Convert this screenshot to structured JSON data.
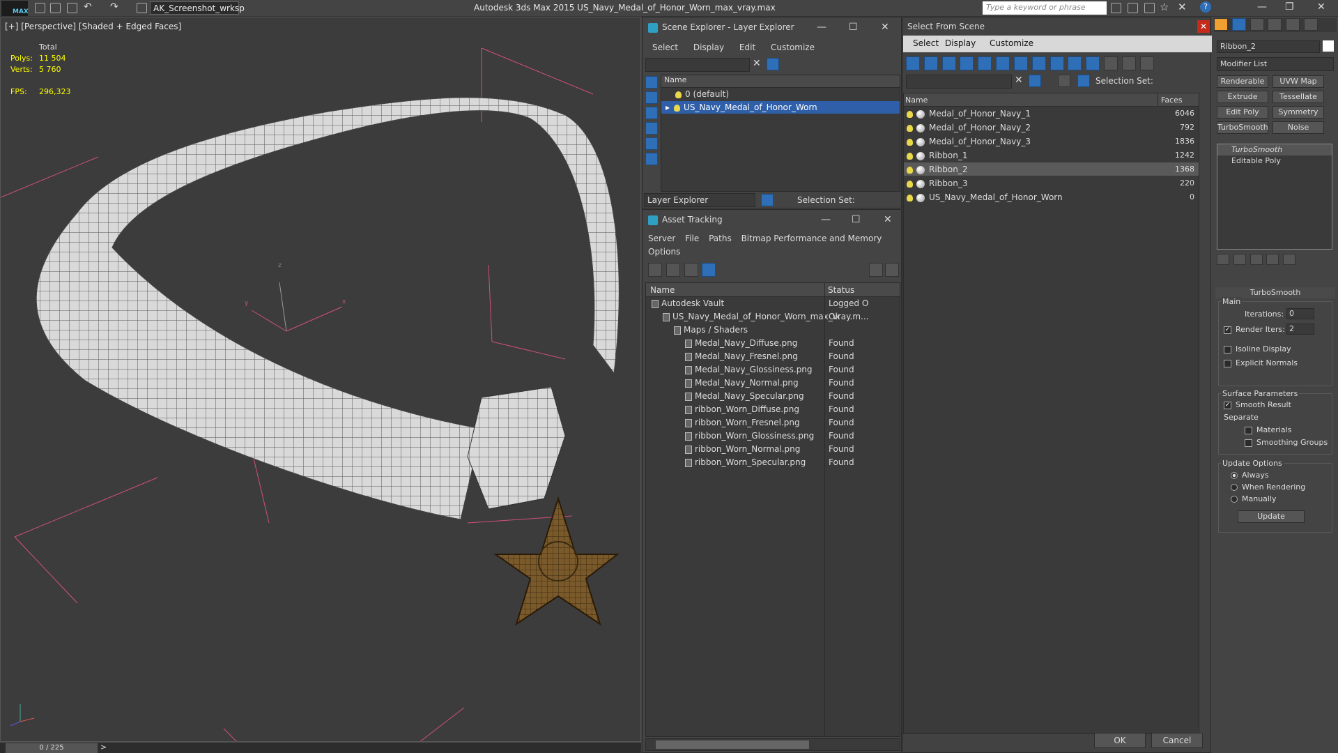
{
  "titlebar": {
    "logo": "MAX",
    "workspace": "AK_Screenshot_wrksp",
    "app_title": "Autodesk 3ds Max  2015    US_Navy_Medal_of_Honor_Worn_max_vray.max",
    "keyword_placeholder": "Type a keyword or phrase"
  },
  "viewport": {
    "label": "[+] [Perspective] [Shaded + Edged Faces]",
    "stats": {
      "total_label": "Total",
      "polys_label": "Polys:",
      "polys_value": "11 504",
      "verts_label": "Verts:",
      "verts_value": "5 760",
      "fps_label": "FPS:",
      "fps_value": "296,323"
    },
    "axis_x": "x",
    "axis_y": "y",
    "axis_z": "z"
  },
  "timeline": {
    "frame": "0 / 225"
  },
  "scene_explorer": {
    "title": "Scene Explorer - Layer Explorer",
    "menu": [
      "Select",
      "Display",
      "Edit",
      "Customize"
    ],
    "col_name": "Name",
    "layers": [
      "0 (default)",
      "US_Navy_Medal_of_Honor_Worn"
    ],
    "footer_label": "Layer Explorer",
    "selection_set": "Selection Set:"
  },
  "asset_tracking": {
    "title": "Asset Tracking",
    "menu": [
      "Server",
      "File",
      "Paths",
      "Bitmap Performance and Memory"
    ],
    "menu2": "Options",
    "col_name": "Name",
    "col_status": "Status",
    "rows": [
      {
        "name": "Autodesk Vault",
        "status": "Logged O",
        "indent": 0
      },
      {
        "name": "US_Navy_Medal_of_Honor_Worn_max_vray.m...",
        "status": "Ok",
        "indent": 1
      },
      {
        "name": "Maps / Shaders",
        "status": "",
        "indent": 2
      },
      {
        "name": "Medal_Navy_Diffuse.png",
        "status": "Found",
        "indent": 3
      },
      {
        "name": "Medal_Navy_Fresnel.png",
        "status": "Found",
        "indent": 3
      },
      {
        "name": "Medal_Navy_Glossiness.png",
        "status": "Found",
        "indent": 3
      },
      {
        "name": "Medal_Navy_Normal.png",
        "status": "Found",
        "indent": 3
      },
      {
        "name": "Medal_Navy_Specular.png",
        "status": "Found",
        "indent": 3
      },
      {
        "name": "ribbon_Worn_Diffuse.png",
        "status": "Found",
        "indent": 3
      },
      {
        "name": "ribbon_Worn_Fresnel.png",
        "status": "Found",
        "indent": 3
      },
      {
        "name": "ribbon_Worn_Glossiness.png",
        "status": "Found",
        "indent": 3
      },
      {
        "name": "ribbon_Worn_Normal.png",
        "status": "Found",
        "indent": 3
      },
      {
        "name": "ribbon_Worn_Specular.png",
        "status": "Found",
        "indent": 3
      }
    ]
  },
  "select_from_scene": {
    "title": "Select From Scene",
    "menu": [
      "Select",
      "Display",
      "Customize"
    ],
    "selection_set": "Selection Set:",
    "col_name": "Name",
    "col_faces": "Faces",
    "rows": [
      {
        "name": "Medal_of_Honor_Navy_1",
        "faces": "6046"
      },
      {
        "name": "Medal_of_Honor_Navy_2",
        "faces": "792"
      },
      {
        "name": "Medal_of_Honor_Navy_3",
        "faces": "1836"
      },
      {
        "name": "Ribbon_1",
        "faces": "1242"
      },
      {
        "name": "Ribbon_2",
        "faces": "1368"
      },
      {
        "name": "Ribbon_3",
        "faces": "220"
      },
      {
        "name": "US_Navy_Medal_of_Honor_Worn",
        "faces": "0"
      }
    ],
    "ok": "OK",
    "cancel": "Cancel"
  },
  "command_panel": {
    "object_name": "Ribbon_2",
    "modifier_list": "Modifier List",
    "buttons": [
      "Renderable Spline",
      "UVW Map",
      "Extrude",
      "Tessellate",
      "Edit Poly",
      "Symmetry",
      "TurboSmooth",
      "Noise"
    ],
    "stack": [
      "TurboSmooth",
      "Editable Poly"
    ],
    "rollout_title": "TurboSmooth",
    "main_label": "Main",
    "iterations_label": "Iterations:",
    "iterations_value": "0",
    "render_iters_label": "Render Iters:",
    "render_iters_value": "2",
    "isoline": "Isoline Display",
    "explicit_normals": "Explicit Normals",
    "surface_params": "Surface Parameters",
    "smooth_result": "Smooth Result",
    "separate": "Separate",
    "materials": "Materials",
    "smoothing_groups": "Smoothing Groups",
    "update_options": "Update Options",
    "always": "Always",
    "when_rendering": "When Rendering",
    "manually": "Manually",
    "update": "Update"
  }
}
